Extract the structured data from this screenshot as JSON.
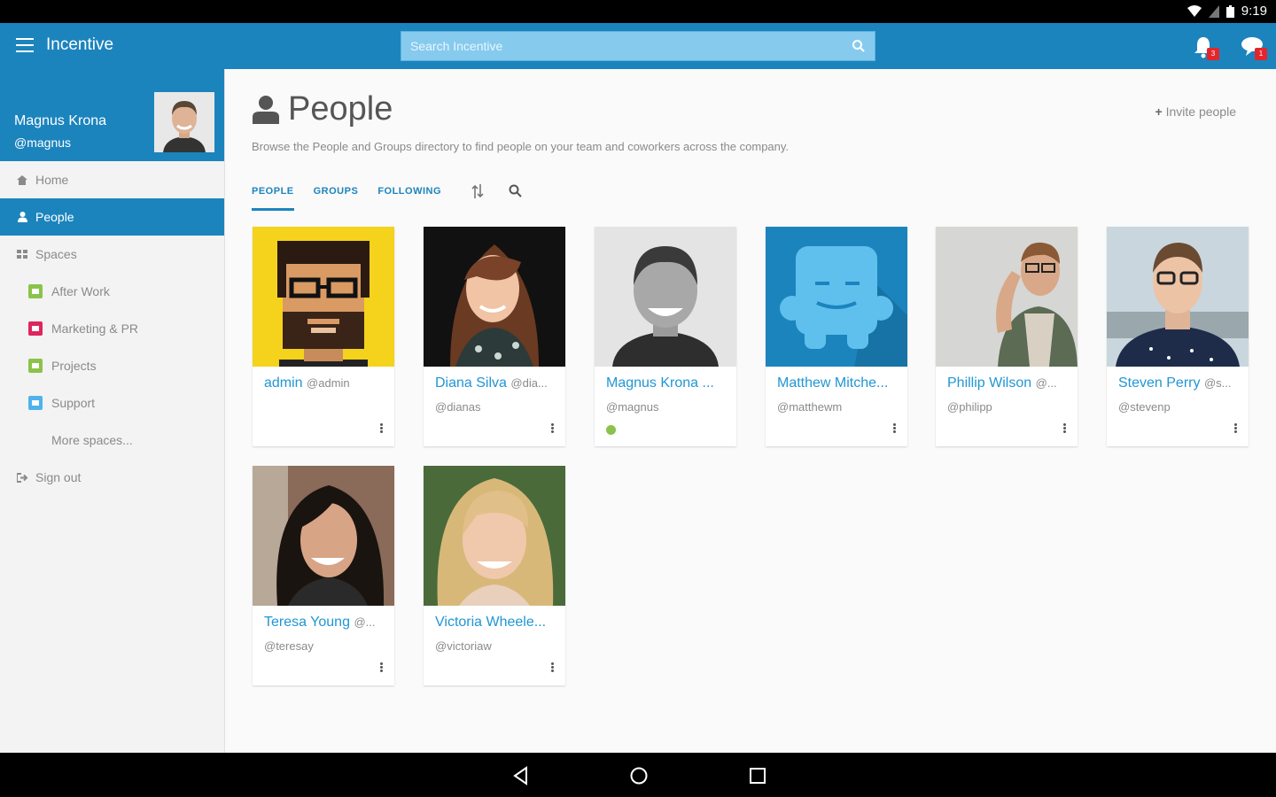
{
  "status_bar": {
    "time": "9:19"
  },
  "app_bar": {
    "title": "Incentive",
    "search_placeholder": "Search Incentive",
    "notification_count": "3",
    "message_count": "1"
  },
  "profile": {
    "name": "Magnus Krona",
    "handle": "@magnus"
  },
  "sidebar": {
    "home": "Home",
    "people": "People",
    "spaces": "Spaces",
    "space_items": [
      {
        "label": "After Work",
        "color": "#8bc34a"
      },
      {
        "label": "Marketing & PR",
        "color": "#e0245e"
      },
      {
        "label": "Projects",
        "color": "#8bc34a"
      },
      {
        "label": "Support",
        "color": "#4fb3ea"
      }
    ],
    "more_spaces": "More spaces...",
    "sign_out": "Sign out"
  },
  "main": {
    "title": "People",
    "invite": "Invite people",
    "description": "Browse the People and Groups directory to find people on your team and coworkers across the company.",
    "tabs": [
      "PEOPLE",
      "GROUPS",
      "FOLLOWING"
    ]
  },
  "people": [
    {
      "name": "admin",
      "handle_inline": "@admin",
      "handle": ""
    },
    {
      "name": "Diana Silva",
      "handle_inline": "@dia...",
      "handle": "@dianas"
    },
    {
      "name": "Magnus Krona ...",
      "handle_inline": "",
      "handle": "@magnus",
      "online": true
    },
    {
      "name": "Matthew Mitche...",
      "handle_inline": "",
      "handle": "@matthewm"
    },
    {
      "name": "Phillip Wilson",
      "handle_inline": "@...",
      "handle": "@philipp"
    },
    {
      "name": "Steven Perry",
      "handle_inline": "@s...",
      "handle": "@stevenp"
    },
    {
      "name": "Teresa Young",
      "handle_inline": "@...",
      "handle": "@teresay"
    },
    {
      "name": "Victoria Wheele...",
      "handle_inline": "",
      "handle": "@victoriaw"
    }
  ],
  "colors": {
    "brand": "#1c84bd",
    "link": "#2196d4",
    "online": "#8bc34a",
    "badge": "#e3262c"
  }
}
